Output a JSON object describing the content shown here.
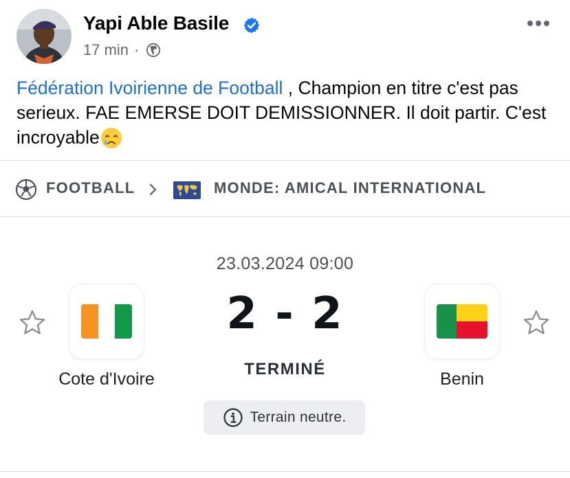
{
  "post": {
    "author_name": "Yapi Able Basile",
    "time_ago": "17 min",
    "separator": "·",
    "mention": "Fédération Ivoirienne de Football",
    "text": " , Champion en titre c'est pas serieux. FAE EMERSE DOIT DEMISSIONNER. Il doit partir. C'est incroyable",
    "emoji": "crying-face-icon",
    "icons": {
      "verified": "verified-badge-icon",
      "audience": "globe-icon",
      "more": "more-options-icon"
    },
    "colors": {
      "mention": "#1b6fd8",
      "verified": "#1877f2"
    }
  },
  "breadcrumb": {
    "sport_icon": "soccer-ball-icon",
    "sport": "FOOTBALL",
    "region_icon": "world-map-icon",
    "competition": "MONDE: AMICAL INTERNATIONAL"
  },
  "match": {
    "datetime": "23.03.2024 09:00",
    "home_team": {
      "name": "Cote d'Ivoire",
      "flag": "ivory-coast-flag-icon"
    },
    "away_team": {
      "name": "Benin",
      "flag": "benin-flag-icon"
    },
    "score": "2 - 2",
    "status": "TERMINÉ",
    "venue_note": "Terrain neutre."
  }
}
